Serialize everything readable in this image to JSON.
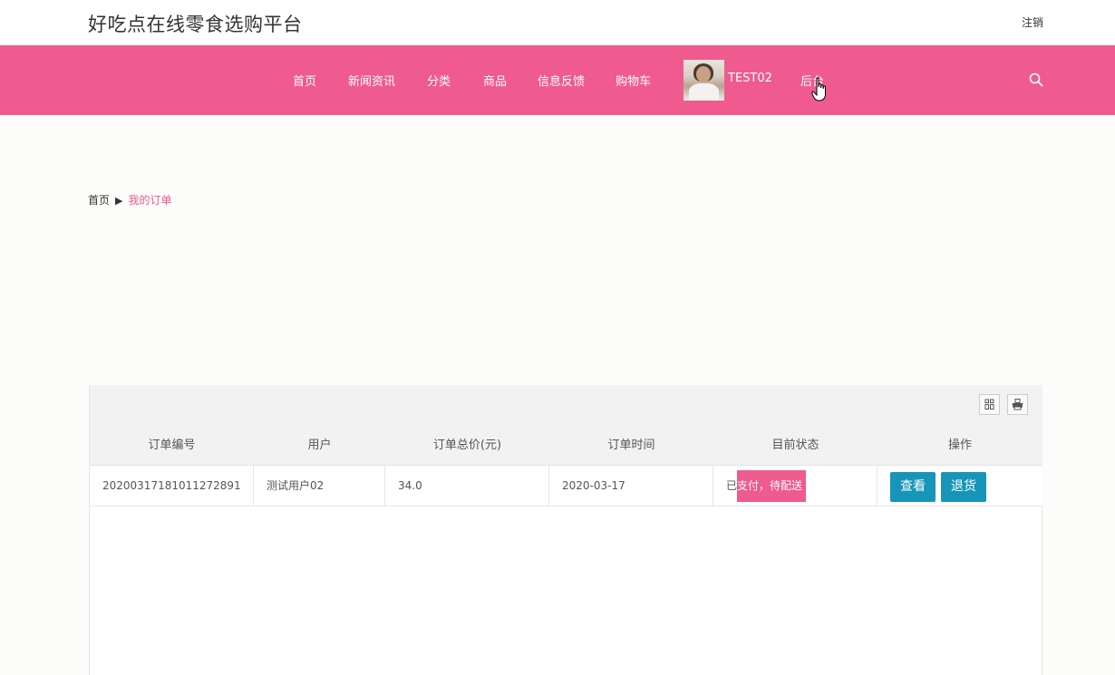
{
  "header": {
    "site_title": "好吃点在线零食选购平台",
    "logout_label": "注销"
  },
  "nav": {
    "items": [
      {
        "label": "首页"
      },
      {
        "label": "新闻资讯"
      },
      {
        "label": "分类"
      },
      {
        "label": "商品"
      },
      {
        "label": "信息反馈"
      },
      {
        "label": "购物车"
      }
    ],
    "username": "TEST02",
    "admin_label": "后台",
    "background_color": "#ef5b8f"
  },
  "breadcrumb": {
    "home": "首页",
    "separator": "▶",
    "current": "我的订单"
  },
  "orders_table": {
    "columns": [
      "订单编号",
      "用户",
      "订单总价(元)",
      "订单时间",
      "目前状态",
      "操作"
    ],
    "rows": [
      {
        "order_no": "20200317181011272891",
        "user": "测试用户02",
        "total": "34.0",
        "time": "2020-03-17",
        "status": "已支付，待配送",
        "actions": [
          "查看",
          "退货"
        ]
      }
    ],
    "action_button_color": "#1795b8"
  }
}
